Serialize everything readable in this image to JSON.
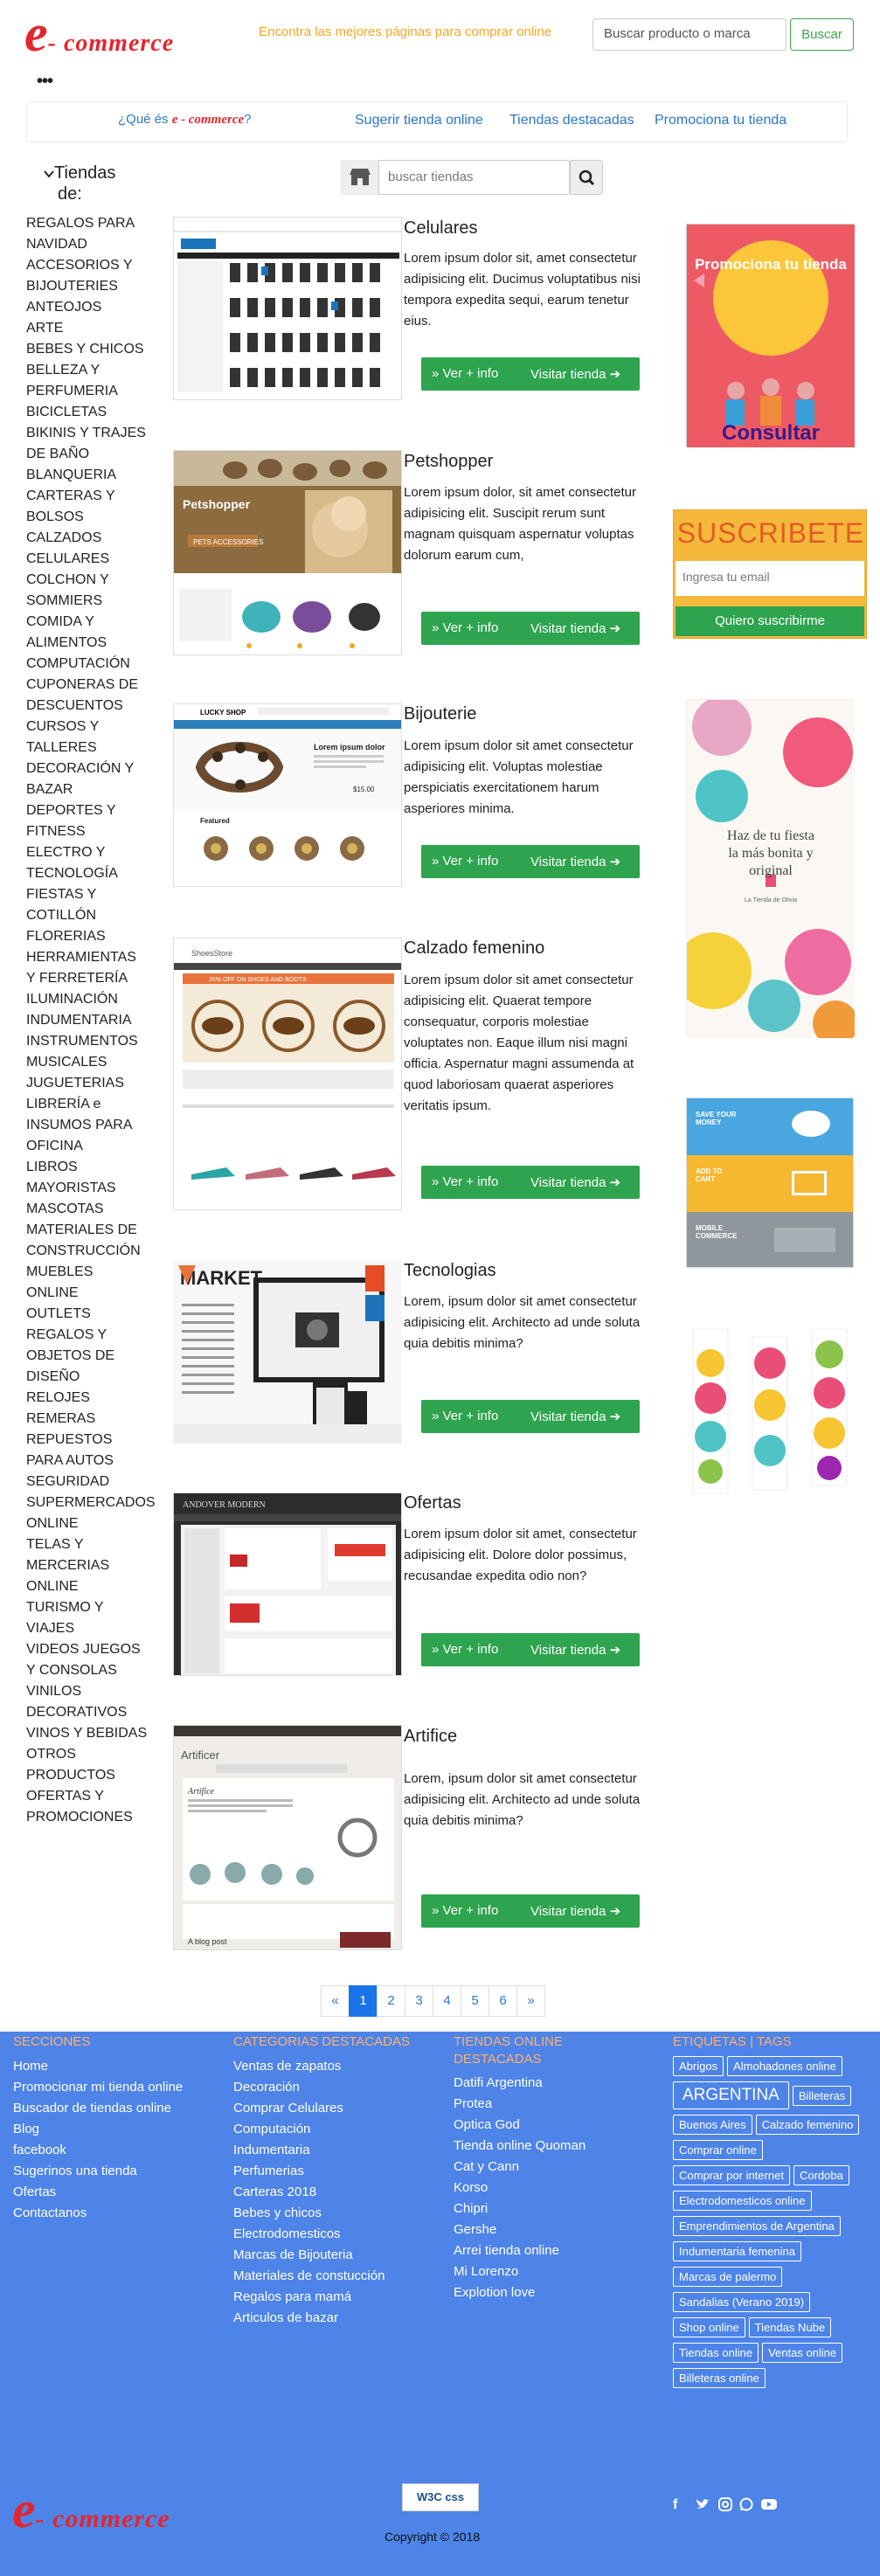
{
  "header": {
    "logo_e": "e",
    "logo_rest": "- commerce",
    "tagline": "Encontra las mejores páginas para comprar online",
    "search_placeholder": "Buscar producto o marca",
    "search_button": "Buscar"
  },
  "nav": {
    "what_prefix": "¿Qué és ",
    "what_logo": "e - commerce",
    "what_suffix": "?",
    "items": [
      "Sugerir tienda online",
      "Tiendas destacadas",
      "Promociona tu tienda"
    ]
  },
  "sidebar": {
    "title_line1": "Tiendas",
    "title_line2": "de:",
    "categories": [
      "REGALOS PARA NAVIDAD",
      "ACCESORIOS Y BIJOUTERIES",
      "ANTEOJOS",
      "ARTE",
      "BEBES Y CHICOS",
      "BELLEZA Y PERFUMERIA",
      "BICICLETAS",
      "BIKINIS Y TRAJES DE BAÑO",
      "BLANQUERIA",
      "CARTERAS Y BOLSOS",
      "CALZADOS",
      "CELULARES",
      "COLCHON Y SOMMIERS",
      "COMIDA Y ALIMENTOS",
      "COMPUTACIÓN",
      "CUPONERAS DE DESCUENTOS",
      "CURSOS Y TALLERES",
      "DECORACIÓN Y BAZAR",
      "DEPORTES Y FITNESS",
      "ELECTRO Y TECNOLOGÍA",
      "FIESTAS Y COTILLÓN",
      "FLORERIAS",
      "HERRAMIENTAS Y FERRETERÍA",
      "ILUMINACIÓN",
      "INDUMENTARIA",
      "INSTRUMENTOS MUSICALES",
      "JUGUETERIAS",
      "LIBRERÍA e INSUMOS PARA OFICINA",
      "LIBROS",
      "MAYORISTAS",
      "MASCOTAS",
      "MATERIALES DE CONSTRUCCIÓN",
      "MUEBLES ONLINE",
      "OUTLETS",
      "REGALOS Y OBJETOS DE DISEÑO",
      "RELOJES",
      "REMERAS",
      "REPUESTOS PARA AUTOS",
      "SEGURIDAD",
      "SUPERMERCADOS ONLINE",
      "TELAS Y MERCERIAS ONLINE",
      "TURISMO Y VIAJES",
      "VIDEOS JUEGOS Y CONSOLAS",
      "VINILOS DECORATIVOS",
      "VINOS Y BEBIDAS",
      "OTROS PRODUCTOS",
      "OFERTAS Y PROMOCIONES"
    ]
  },
  "store_search": {
    "placeholder": "buscar tiendas"
  },
  "stores": [
    {
      "title": "Celulares",
      "desc": "Lorem ipsum dolor sit, amet consectetur adipisicing elit. Ducimus voluptatibus nisi tempora expedita sequi, earum tenetur eius.",
      "more": "Ver + info",
      "visit": "Visitar tienda"
    },
    {
      "title": "Petshopper",
      "desc": "Lorem ipsum dolor, sit amet consectetur adipisicing elit. Suscipit rerum sunt magnam quisquam aspernatur voluptas dolorum earum cum,",
      "more": "Ver + info",
      "visit": "Visitar tienda"
    },
    {
      "title": "Bijouterie",
      "desc": "Lorem ipsum dolor sit amet consectetur adipisicing elit. Voluptas molestiae perspiciatis exercitationem harum asperiores minima.",
      "more": "Ver + info",
      "visit": "Visitar tienda"
    },
    {
      "title": "Calzado femenino",
      "desc": "Lorem ipsum dolor sit amet consectetur adipisicing elit. Quaerat tempore consequatur, corporis molestiae voluptates non. Eaque illum nisi magni officia. Aspernatur magni assumenda at quod laboriosam quaerat asperiores veritatis ipsum.",
      "more": "Ver + info",
      "visit": "Visitar tienda"
    },
    {
      "title": "Tecnologias",
      "desc": "Lorem, ipsum dolor sit amet consectetur adipisicing elit. Architecto ad unde soluta quia debitis minima?",
      "more": "Ver + info",
      "visit": "Visitar tienda"
    },
    {
      "title": "Ofertas",
      "desc": "Lorem ipsum dolor sit amet, consectetur adipisicing elit. Dolore dolor possimus, recusandae expedita odio non?",
      "more": "Ver + info",
      "visit": "Visitar tienda"
    },
    {
      "title": "Artifice",
      "desc": "Lorem, ipsum dolor sit amet consectetur adipisicing elit. Architecto ad unde soluta quia debitis minima?",
      "more": "Ver + info",
      "visit": "Visitar tienda"
    }
  ],
  "store_thumb_labels": {
    "petshopper_brand": "Petshopper",
    "petshopper_banner": "PETS ACCESSORIES",
    "bijou_brand": "LUCKY SHOP",
    "bijou_heading": "Lorem ipsum dolor",
    "bijou_price": "$15.00",
    "bijou_featured": "Featured",
    "shoe_brand": "ShoesStore",
    "shoe_banner": "25% OFF ON SHOES AND BOOTS",
    "tech_brand": "MARKET",
    "ofertas_brand": "ANDOVER MODERN",
    "artifice_brand": "Artificer",
    "artifice_heading": "Artifice",
    "artifice_blog": "A blog post"
  },
  "right_ads": {
    "promo_text": "Promociona tu tienda",
    "promo_consultar": "Consultar",
    "subscribe_title": "SUSCRIBETE",
    "subscribe_placeholder": "Ingresa tu email",
    "subscribe_button": "Quiero suscribirme",
    "party_text": "Haz de tu fiesta la más bonita y original",
    "party_brand": "La Tienda de Olivia",
    "money_lines": [
      "SAVE YOUR MONEY",
      "ADD TO CART",
      "MOBILE COMMERCE"
    ]
  },
  "pagination": [
    "«",
    "1",
    "2",
    "3",
    "4",
    "5",
    "6",
    "»"
  ],
  "pagination_active": "1",
  "footer": {
    "col1_title": "SECCIONES",
    "col1_items": [
      "Home",
      "Promocionar mi tienda online",
      "Buscador de tiendas online",
      "Blog",
      "facebook",
      "Sugerinos una tienda",
      "Ofertas",
      "Contactanos"
    ],
    "col2_title": "CATEGORIAS DESTACADAS",
    "col2_items": [
      "Ventas de zapatos",
      "Decoración",
      "Comprar Celulares",
      "Computación",
      "Indumentaria",
      "Perfumerias",
      "Carteras 2018",
      "Bebes y chicos",
      "Electrodomesticos",
      "Marcas de Bijouteria",
      "Materiales de constucción",
      "Regalos para mamá",
      "Articulos de bazar"
    ],
    "col3_title_line1": "TIENDAS ONLINE",
    "col3_title_line2": "DESTACADAS",
    "col3_items": [
      "Datifi Argentina",
      "Protea",
      "Optica God",
      "Tienda online Quoman",
      "Cat y Cann",
      "Korso",
      "Chipri",
      "Gershe",
      "Arrei tienda online",
      "Mi Lorenzo",
      "Explotion love"
    ],
    "col4_title": "ETIQUETAS | TAGS",
    "tags": [
      "Abrigos",
      "Almohadones online",
      "ARGENTINA",
      "Billeteras",
      "Buenos Aires",
      "Calzado femenino",
      "Comprar online",
      "Comprar por internet",
      "Cordoba",
      "Electrodomesticos online",
      "Emprendimientos de Argentina",
      "Indumentaria femenina",
      "Marcas de palermo",
      "Sandalias (Verano 2019)",
      "Shop online",
      "Tiendas Nube",
      "Tiendas online",
      "Ventas online",
      "Billeteras online"
    ],
    "w3c_badge": "W3C css",
    "copyright": "Copyright © 2018",
    "social_icons": [
      "facebook-icon",
      "twitter-icon",
      "instagram-icon",
      "whatsapp-icon",
      "youtube-icon"
    ]
  },
  "colors": {
    "brand_red": "#e3262d",
    "accent_orange": "#f5a623",
    "link_blue": "#2a77c9",
    "button_green": "#2ea44f",
    "footer_blue": "#4e84e8"
  }
}
